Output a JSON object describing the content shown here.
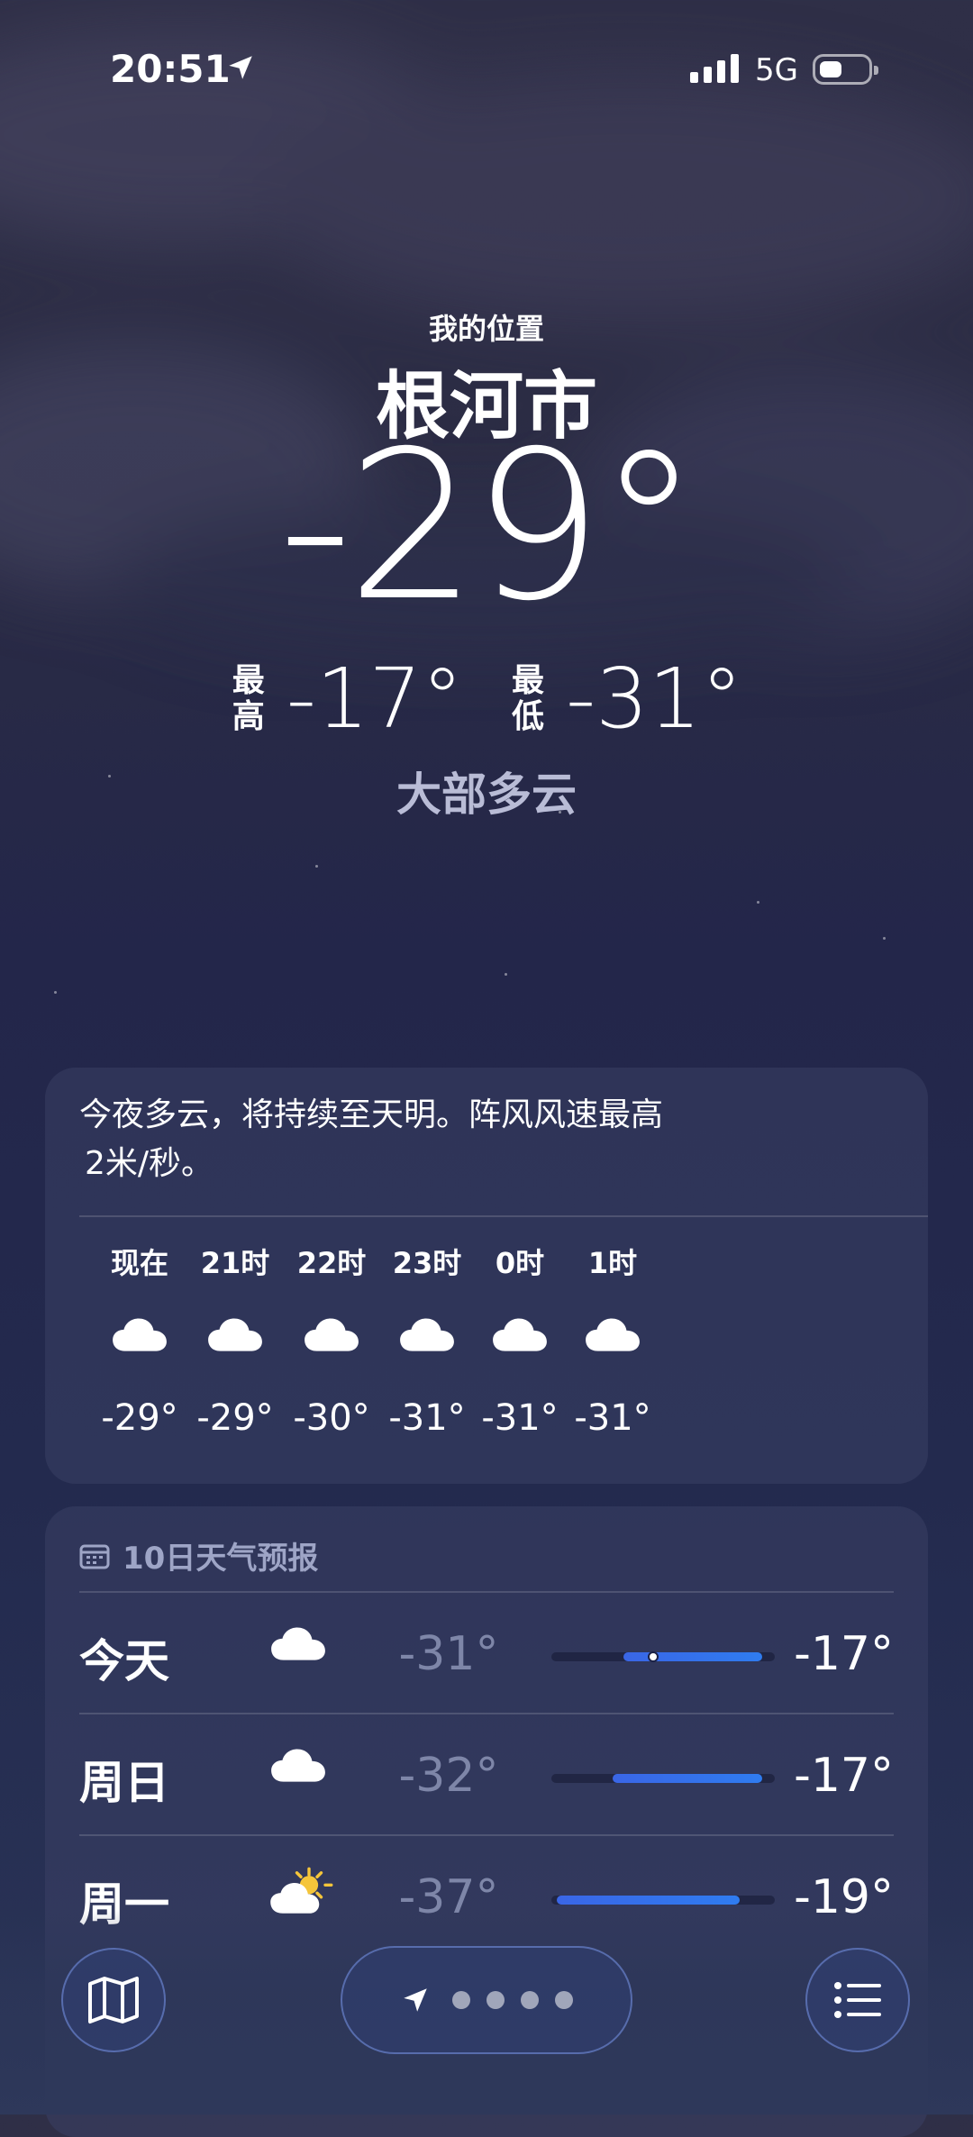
{
  "status_bar": {
    "time": "20:51",
    "network": "5G"
  },
  "header": {
    "my_location": "我的位置",
    "city": "根河市",
    "current_temp": "-29°",
    "high_label_1": "最",
    "high_label_2": "高",
    "high_value": "-17°",
    "low_label_1": "最",
    "low_label_2": "低",
    "low_value": "-31°",
    "condition": "大部多云"
  },
  "hourly": {
    "summary_line1": "今夜多云，将持续至天明。阵风风速最高",
    "summary_line2": "2米/秒。",
    "items": [
      {
        "label": "现在",
        "icon": "cloud-icon",
        "temp": "-29°"
      },
      {
        "label": "21时",
        "icon": "cloud-icon",
        "temp": "-29°"
      },
      {
        "label": "22时",
        "icon": "cloud-icon",
        "temp": "-30°"
      },
      {
        "label": "23时",
        "icon": "cloud-icon",
        "temp": "-31°"
      },
      {
        "label": "0时",
        "icon": "cloud-icon",
        "temp": "-31°"
      },
      {
        "label": "1时",
        "icon": "cloud-icon",
        "temp": "-31°"
      }
    ]
  },
  "daily": {
    "title": "10日天气预报",
    "days": [
      {
        "day": "今天",
        "icon": "cloud-icon",
        "low": "-31°",
        "high": "-17°",
        "range_low": -31,
        "range_high": -17,
        "current": -29
      },
      {
        "day": "周日",
        "icon": "cloud-icon",
        "low": "-32°",
        "high": "-17°",
        "range_low": -32,
        "range_high": -17
      },
      {
        "day": "周一",
        "icon": "partly-sunny-icon",
        "low": "-37°",
        "high": "-19°",
        "range_low": -37,
        "range_high": -19
      }
    ]
  },
  "toolbar": {
    "map_icon": "map-icon",
    "location_icon": "location-arrow-icon",
    "list_icon": "list-icon",
    "page_dots": 4
  },
  "colors": {
    "bar_gradient_start": "#3a66e6",
    "bar_gradient_end": "#2f7cf0",
    "condition_text": "#b9bcd6"
  }
}
